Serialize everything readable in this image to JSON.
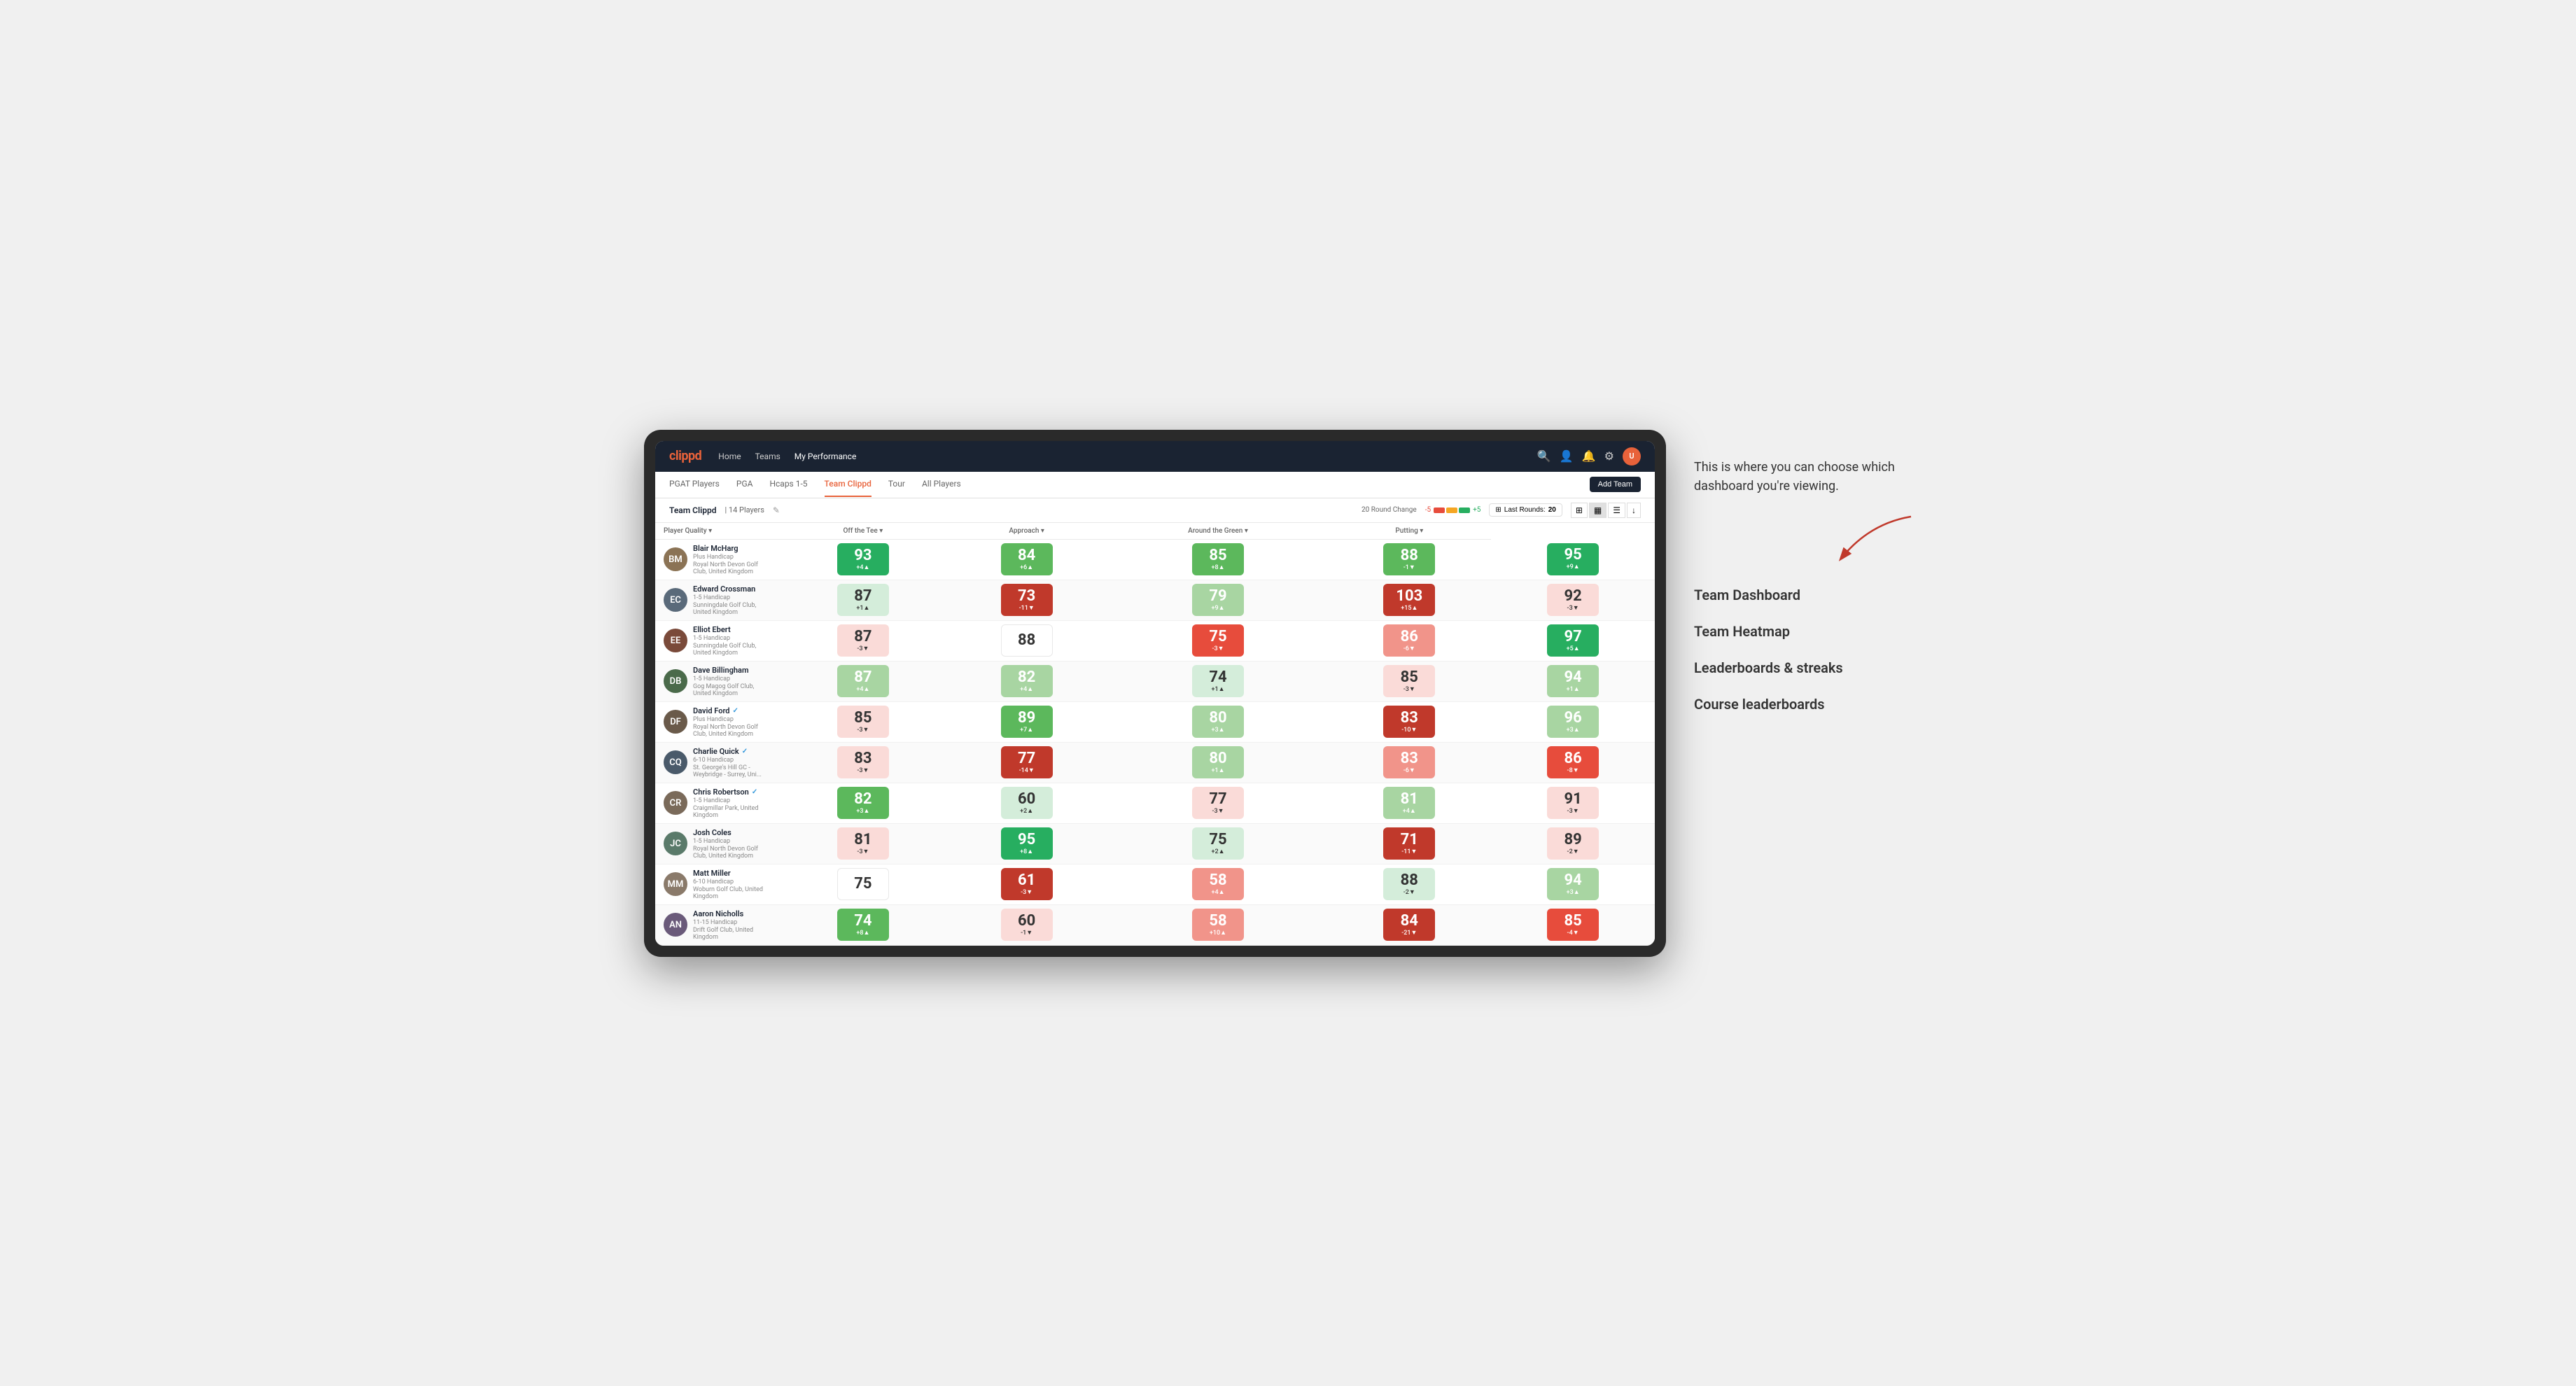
{
  "annotation": {
    "description": "This is where you can choose which dashboard you're viewing.",
    "menu_items": [
      "Team Dashboard",
      "Team Heatmap",
      "Leaderboards & streaks",
      "Course leaderboards"
    ]
  },
  "nav": {
    "logo": "clippd",
    "links": [
      "Home",
      "Teams",
      "My Performance"
    ],
    "active_link": "My Performance"
  },
  "sub_nav": {
    "links": [
      "PGAT Players",
      "PGA",
      "Hcaps 1-5",
      "Team Clippd",
      "Tour",
      "All Players"
    ],
    "active_link": "Team Clippd",
    "add_team_label": "Add Team"
  },
  "team_bar": {
    "name": "Team Clippd",
    "separator": "|",
    "count_label": "14 Players",
    "round_change_label": "20 Round Change",
    "neg_value": "-5",
    "pos_value": "+5",
    "last_rounds_label": "Last Rounds:",
    "last_rounds_value": "20"
  },
  "table": {
    "col_headers": [
      "Player Quality ▾",
      "Off the Tee ▾",
      "Approach ▾",
      "Around the Green ▾",
      "Putting ▾"
    ],
    "players": [
      {
        "name": "Blair McHarg",
        "handicap": "Plus Handicap",
        "club": "Royal North Devon Golf Club, United Kingdom",
        "avatar_color": "#8B7355",
        "avatar_initials": "BM",
        "scores": [
          {
            "value": 93,
            "change": "+4",
            "dir": "up",
            "color": "bg-green-dark"
          },
          {
            "value": 84,
            "change": "+6",
            "dir": "up",
            "color": "bg-green-med"
          },
          {
            "value": 85,
            "change": "+8",
            "dir": "up",
            "color": "bg-green-med"
          },
          {
            "value": 88,
            "change": "-1",
            "dir": "down",
            "color": "bg-green-med"
          },
          {
            "value": 95,
            "change": "+9",
            "dir": "up",
            "color": "bg-green-dark"
          }
        ]
      },
      {
        "name": "Edward Crossman",
        "handicap": "1-5 Handicap",
        "club": "Sunningdale Golf Club, United Kingdom",
        "avatar_color": "#5a6a7a",
        "avatar_initials": "EC",
        "scores": [
          {
            "value": 87,
            "change": "+1",
            "dir": "up",
            "color": "bg-green-pale"
          },
          {
            "value": 73,
            "change": "-11",
            "dir": "down",
            "color": "bg-red-dark"
          },
          {
            "value": 79,
            "change": "+9",
            "dir": "up",
            "color": "bg-green-light"
          },
          {
            "value": 103,
            "change": "+15",
            "dir": "up",
            "color": "bg-red-dark"
          },
          {
            "value": 92,
            "change": "-3",
            "dir": "down",
            "color": "bg-red-pale"
          }
        ]
      },
      {
        "name": "Elliot Ebert",
        "handicap": "1-5 Handicap",
        "club": "Sunningdale Golf Club, United Kingdom",
        "avatar_color": "#7a4a3a",
        "avatar_initials": "EE",
        "scores": [
          {
            "value": 87,
            "change": "-3",
            "dir": "down",
            "color": "bg-red-pale"
          },
          {
            "value": 88,
            "change": "",
            "dir": "",
            "color": "bg-white"
          },
          {
            "value": 75,
            "change": "-3",
            "dir": "down",
            "color": "bg-red-med"
          },
          {
            "value": 86,
            "change": "-6",
            "dir": "down",
            "color": "bg-red-light"
          },
          {
            "value": 97,
            "change": "+5",
            "dir": "up",
            "color": "bg-green-dark"
          }
        ]
      },
      {
        "name": "Dave Billingham",
        "handicap": "1-5 Handicap",
        "club": "Gog Magog Golf Club, United Kingdom",
        "avatar_color": "#4a6a4a",
        "avatar_initials": "DB",
        "scores": [
          {
            "value": 87,
            "change": "+4",
            "dir": "up",
            "color": "bg-green-light"
          },
          {
            "value": 82,
            "change": "+4",
            "dir": "up",
            "color": "bg-green-light"
          },
          {
            "value": 74,
            "change": "+1",
            "dir": "up",
            "color": "bg-green-pale"
          },
          {
            "value": 85,
            "change": "-3",
            "dir": "down",
            "color": "bg-red-pale"
          },
          {
            "value": 94,
            "change": "+1",
            "dir": "up",
            "color": "bg-green-light"
          }
        ]
      },
      {
        "name": "David Ford",
        "handicap": "Plus Handicap",
        "club": "Royal North Devon Golf Club, United Kingdom",
        "avatar_color": "#6a5a4a",
        "avatar_initials": "DF",
        "verified": true,
        "scores": [
          {
            "value": 85,
            "change": "-3",
            "dir": "down",
            "color": "bg-red-pale"
          },
          {
            "value": 89,
            "change": "+7",
            "dir": "up",
            "color": "bg-green-med"
          },
          {
            "value": 80,
            "change": "+3",
            "dir": "up",
            "color": "bg-green-light"
          },
          {
            "value": 83,
            "change": "-10",
            "dir": "down",
            "color": "bg-red-dark"
          },
          {
            "value": 96,
            "change": "+3",
            "dir": "up",
            "color": "bg-green-light"
          }
        ]
      },
      {
        "name": "Charlie Quick",
        "handicap": "6-10 Handicap",
        "club": "St. George's Hill GC - Weybridge - Surrey, Uni...",
        "avatar_color": "#4a5a6a",
        "avatar_initials": "CQ",
        "verified": true,
        "scores": [
          {
            "value": 83,
            "change": "-3",
            "dir": "down",
            "color": "bg-red-pale"
          },
          {
            "value": 77,
            "change": "-14",
            "dir": "down",
            "color": "bg-red-dark"
          },
          {
            "value": 80,
            "change": "+1",
            "dir": "up",
            "color": "bg-green-light"
          },
          {
            "value": 83,
            "change": "-6",
            "dir": "down",
            "color": "bg-red-light"
          },
          {
            "value": 86,
            "change": "-8",
            "dir": "down",
            "color": "bg-red-med"
          }
        ]
      },
      {
        "name": "Chris Robertson",
        "handicap": "1-5 Handicap",
        "club": "Craigmillar Park, United Kingdom",
        "avatar_color": "#7a6a5a",
        "avatar_initials": "CR",
        "verified": true,
        "scores": [
          {
            "value": 82,
            "change": "+3",
            "dir": "up",
            "color": "bg-green-med"
          },
          {
            "value": 60,
            "change": "+2",
            "dir": "up",
            "color": "bg-green-pale"
          },
          {
            "value": 77,
            "change": "-3",
            "dir": "down",
            "color": "bg-red-pale"
          },
          {
            "value": 81,
            "change": "+4",
            "dir": "up",
            "color": "bg-green-light"
          },
          {
            "value": 91,
            "change": "-3",
            "dir": "down",
            "color": "bg-red-pale"
          }
        ]
      },
      {
        "name": "Josh Coles",
        "handicap": "1-5 Handicap",
        "club": "Royal North Devon Golf Club, United Kingdom",
        "avatar_color": "#5a7a6a",
        "avatar_initials": "JC",
        "scores": [
          {
            "value": 81,
            "change": "-3",
            "dir": "down",
            "color": "bg-red-pale"
          },
          {
            "value": 95,
            "change": "+8",
            "dir": "up",
            "color": "bg-green-dark"
          },
          {
            "value": 75,
            "change": "+2",
            "dir": "up",
            "color": "bg-green-pale"
          },
          {
            "value": 71,
            "change": "-11",
            "dir": "down",
            "color": "bg-red-dark"
          },
          {
            "value": 89,
            "change": "-2",
            "dir": "down",
            "color": "bg-red-pale"
          }
        ]
      },
      {
        "name": "Matt Miller",
        "handicap": "6-10 Handicap",
        "club": "Woburn Golf Club, United Kingdom",
        "avatar_color": "#8a7a6a",
        "avatar_initials": "MM",
        "scores": [
          {
            "value": 75,
            "change": "",
            "dir": "",
            "color": "bg-white"
          },
          {
            "value": 61,
            "change": "-3",
            "dir": "down",
            "color": "bg-red-dark"
          },
          {
            "value": 58,
            "change": "+4",
            "dir": "up",
            "color": "bg-red-light"
          },
          {
            "value": 88,
            "change": "-2",
            "dir": "down",
            "color": "bg-green-pale"
          },
          {
            "value": 94,
            "change": "+3",
            "dir": "up",
            "color": "bg-green-light"
          }
        ]
      },
      {
        "name": "Aaron Nicholls",
        "handicap": "11-15 Handicap",
        "club": "Drift Golf Club, United Kingdom",
        "avatar_color": "#6a5a7a",
        "avatar_initials": "AN",
        "scores": [
          {
            "value": 74,
            "change": "+8",
            "dir": "up",
            "color": "bg-green-med"
          },
          {
            "value": 60,
            "change": "-1",
            "dir": "down",
            "color": "bg-red-pale"
          },
          {
            "value": 58,
            "change": "+10",
            "dir": "up",
            "color": "bg-red-light"
          },
          {
            "value": 84,
            "change": "-21",
            "dir": "down",
            "color": "bg-red-dark"
          },
          {
            "value": 85,
            "change": "-4",
            "dir": "down",
            "color": "bg-red-med"
          }
        ]
      }
    ]
  }
}
